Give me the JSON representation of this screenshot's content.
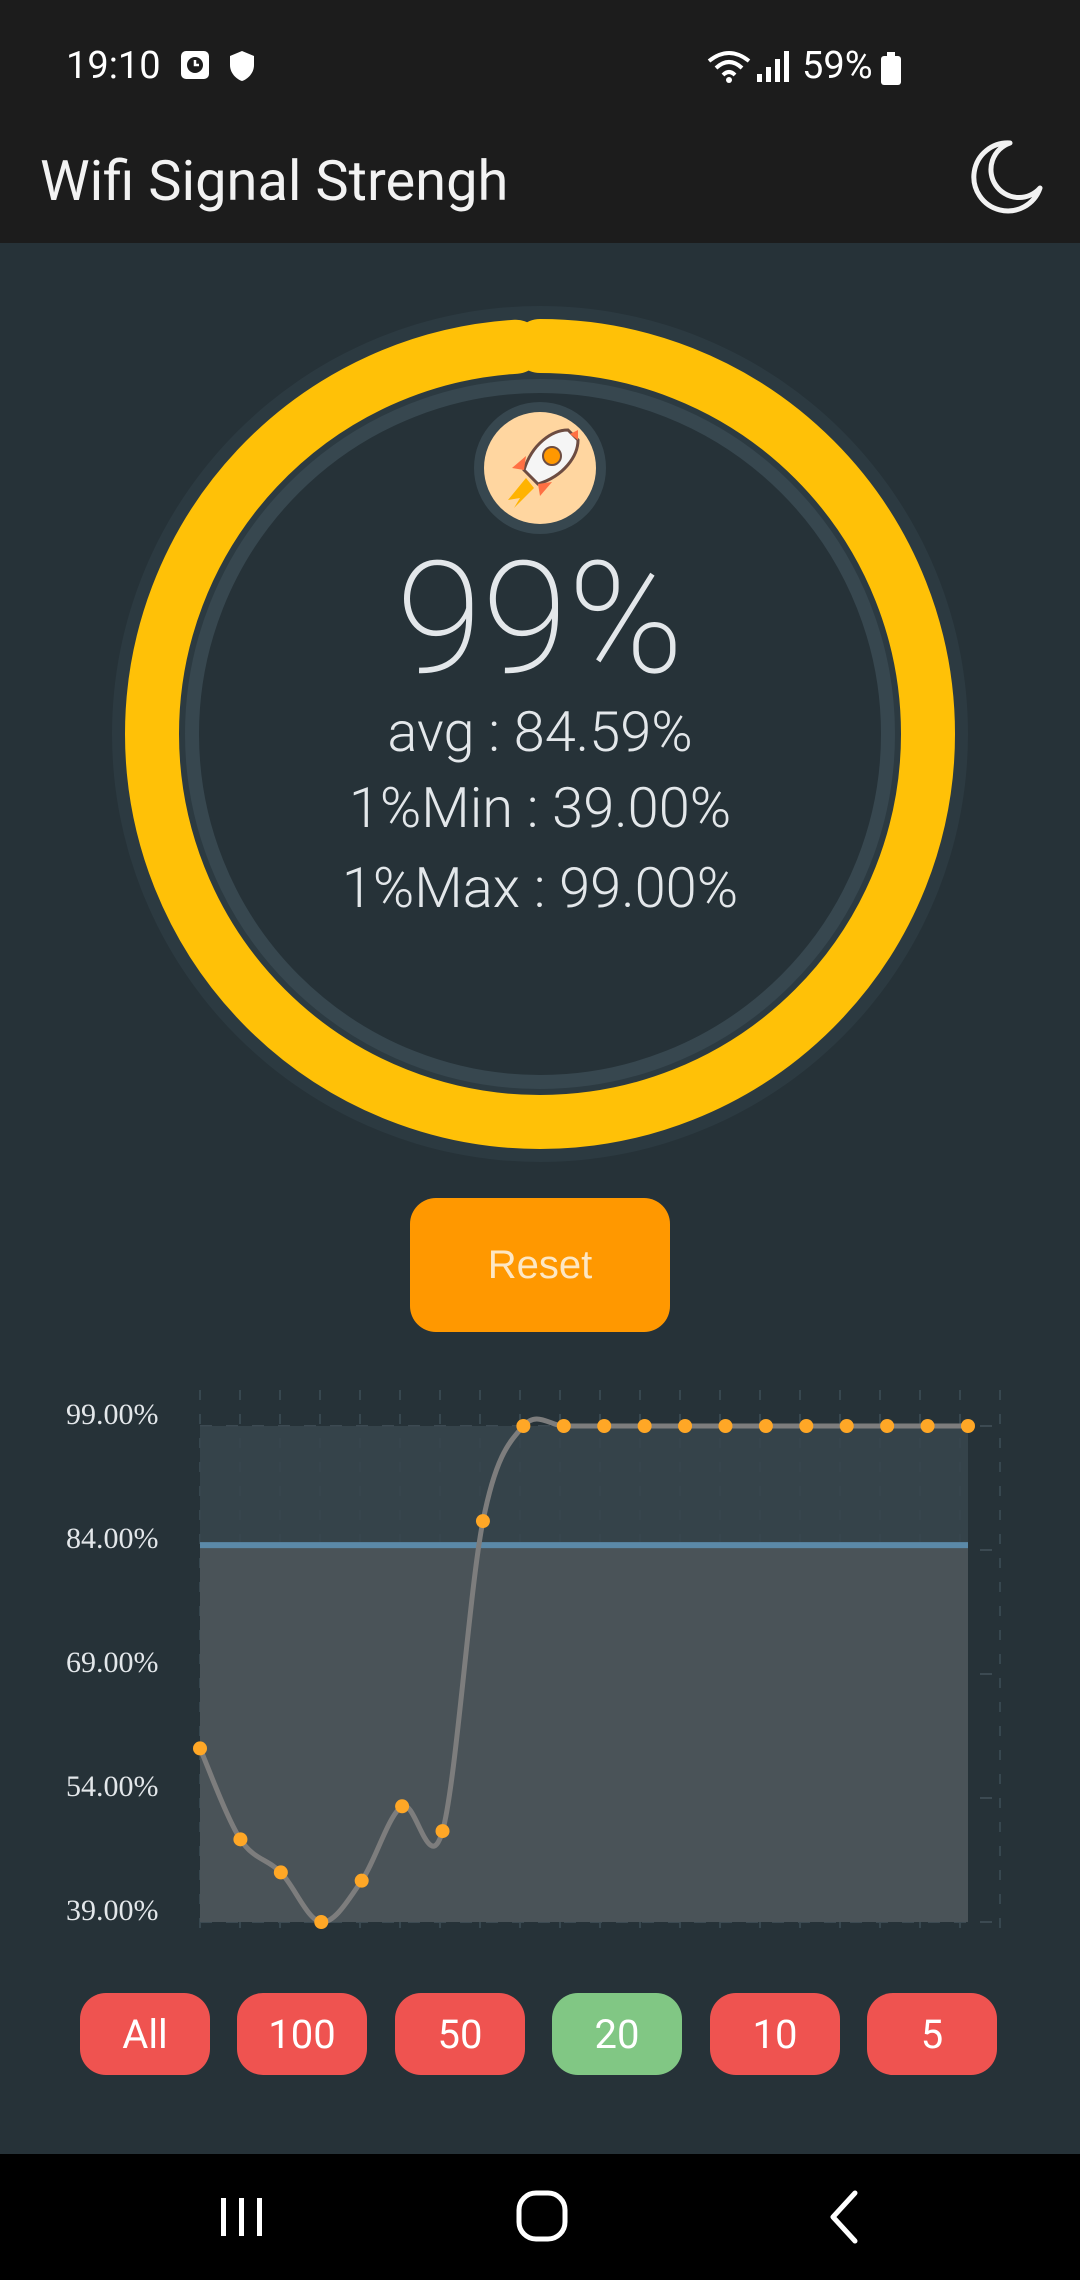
{
  "status_bar": {
    "time": "19:10",
    "battery": "59%",
    "icons": [
      "alarm-clock-icon",
      "shield-icon",
      "wifi-icon",
      "cell-signal-icon",
      "battery-icon"
    ]
  },
  "app_bar": {
    "title": "Wifi Signal Strengh",
    "theme_toggle_icon": "moon-icon"
  },
  "gauge": {
    "value": 99,
    "main": "99%",
    "avg": "avg : 84.59%",
    "min": "1%Min : 39.00%",
    "max": "1%Max : 99.00%",
    "ring_color": "#ffc107",
    "track_color": "#37474f",
    "icon": "rocket-icon"
  },
  "reset_label": "Reset",
  "chart_data": {
    "type": "line",
    "y_ticks": [
      "99.00%",
      "84.00%",
      "69.00%",
      "54.00%",
      "39.00%"
    ],
    "ylim": [
      39,
      99
    ],
    "average": 84.59,
    "series": [
      {
        "values": [
          60,
          49,
          45,
          39,
          44,
          53,
          50,
          87.5,
          99,
          99,
          99,
          99,
          99,
          99,
          99,
          99,
          99,
          99,
          99,
          99
        ],
        "point_color": "#ffa726",
        "line_color": "#7d7d7d"
      }
    ],
    "average_line_color": "#5b89a8",
    "grid": true
  },
  "ranges": [
    {
      "label": "All",
      "active": false
    },
    {
      "label": "100",
      "active": false
    },
    {
      "label": "50",
      "active": false
    },
    {
      "label": "20",
      "active": true
    },
    {
      "label": "10",
      "active": false
    },
    {
      "label": "5",
      "active": false
    }
  ],
  "colors": {
    "range_inactive": "#ef5350",
    "range_active": "#81c784",
    "accent": "#ff9800"
  },
  "nav_bar": [
    "recent-apps-icon",
    "home-icon",
    "back-icon"
  ]
}
